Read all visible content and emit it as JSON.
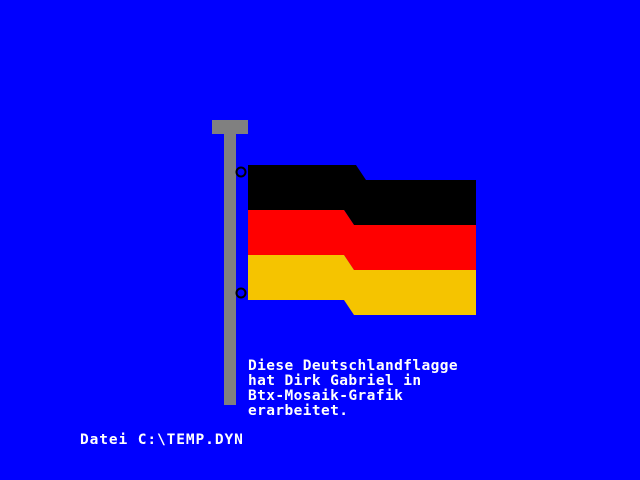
{
  "colors": {
    "background": "#0000ff",
    "pole": "#808080",
    "flag_black": "#000000",
    "flag_red": "#ff0000",
    "flag_gold": "#f5c400",
    "text": "#ffffff"
  },
  "caption": {
    "lines": [
      "Diese Deutschlandflagge",
      "hat Dirk Gabriel in",
      "Btx-Mosaik-Grafik",
      "erarbeitet."
    ]
  },
  "status": {
    "file_line": "Datei C:\\TEMP.DYN"
  }
}
